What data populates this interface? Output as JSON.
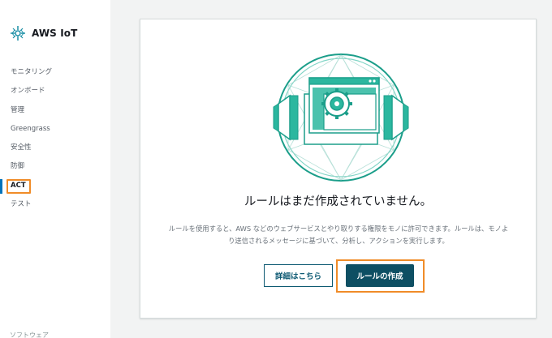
{
  "app": {
    "brand": "AWS IoT"
  },
  "sidebar": {
    "items": [
      {
        "label": "モニタリング"
      },
      {
        "label": "オンボード"
      },
      {
        "label": "管理"
      },
      {
        "label": "Greengrass"
      },
      {
        "label": "安全性"
      },
      {
        "label": "防御"
      },
      {
        "label": "ACT"
      },
      {
        "label": "テスト"
      }
    ],
    "active": "ACT",
    "footer": "ソフトウェア"
  },
  "empty_state": {
    "title": "ルールはまだ作成されていません。",
    "description": "ルールを使用すると、AWS などのウェブサービスとやり取りする権限をモノに許可できます。ルールは、モノより送信されるメッセージに基づいて、分析し、アクションを実行します。",
    "learn_more_label": "詳細はこちら",
    "create_rule_label": "ルールの作成"
  },
  "colors": {
    "accent": "#0e4f63",
    "highlight": "#f08c28",
    "illustration": "#2bb79f"
  }
}
